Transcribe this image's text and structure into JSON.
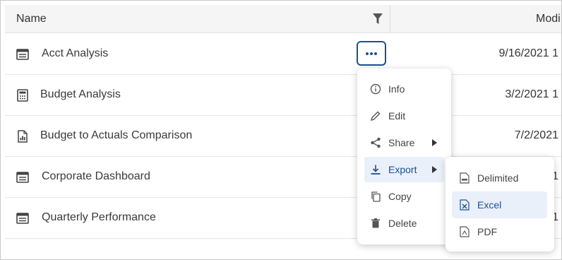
{
  "table": {
    "header": {
      "name": "Name",
      "modified": "Modi",
      "filter_icon": "filter-icon"
    },
    "rows": [
      {
        "name": "Acct Analysis",
        "date": "9/16/2021 1",
        "icon": "table-report-icon"
      },
      {
        "name": "Budget Analysis",
        "date": "3/2/2021 1",
        "icon": "calculator-report-icon"
      },
      {
        "name": "Budget to Actuals Comparison",
        "date": "7/2/2021",
        "icon": "document-chart-icon"
      },
      {
        "name": "Corporate Dashboard",
        "date": "1",
        "icon": "table-report-icon"
      },
      {
        "name": "Quarterly Performance",
        "date": "1",
        "icon": "table-report-icon"
      }
    ]
  },
  "context_menu": {
    "items": [
      {
        "label": "Info",
        "icon": "info-icon"
      },
      {
        "label": "Edit",
        "icon": "pencil-icon"
      },
      {
        "label": "Share",
        "icon": "share-icon",
        "has_submenu": true
      },
      {
        "label": "Export",
        "icon": "download-icon",
        "has_submenu": true,
        "active": true
      },
      {
        "label": "Copy",
        "icon": "copy-icon"
      },
      {
        "label": "Delete",
        "icon": "trash-icon"
      }
    ]
  },
  "export_submenu": {
    "items": [
      {
        "label": "Delimited",
        "icon": "csv-file-icon"
      },
      {
        "label": "Excel",
        "icon": "excel-file-icon",
        "active": true
      },
      {
        "label": "PDF",
        "icon": "pdf-file-icon"
      }
    ]
  },
  "colors": {
    "accent": "#1d4f91",
    "highlight": "#e9f0fa",
    "header_bg": "#f5f5f5",
    "text": "#3a3a3a"
  }
}
